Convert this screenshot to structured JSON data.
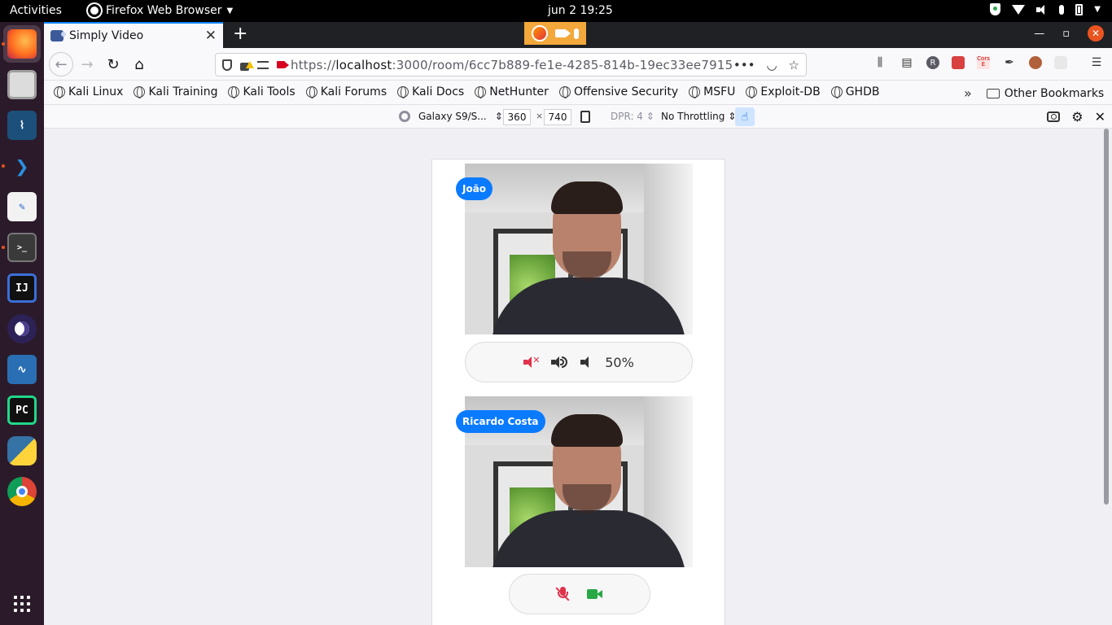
{
  "topbar": {
    "activities": "Activities",
    "app_name": "Firefox Web Browser",
    "clock": "jun 2  19:25"
  },
  "dock": {
    "items": [
      "firefox-icon",
      "files-icon",
      "mysql-workbench-icon",
      "vscode-icon",
      "text-editor-icon",
      "terminal-icon",
      "intellij-icon",
      "eclipse-icon",
      "system-monitor-icon",
      "pycharm-icon",
      "python-icon",
      "chrome-icon"
    ],
    "colors": {
      "active": "#e95420"
    }
  },
  "browser": {
    "tab_title": "Simply Video",
    "url_prefix": "https://",
    "url_host": "localhost",
    "url_rest": ":3000/room/6cc7b889-fe1e-4285-814b-19ec33ee7915",
    "bookmarks": [
      "Kali Linux",
      "Kali Training",
      "Kali Tools",
      "Kali Forums",
      "Kali Docs",
      "NetHunter",
      "Offensive Security",
      "MSFU",
      "Exploit-DB",
      "GHDB"
    ],
    "other_bookmarks": "Other Bookmarks",
    "profile_initial": "R",
    "cors_label": "Cors E"
  },
  "rdm": {
    "device": "Galaxy S9/S...",
    "width": "360",
    "times": "×",
    "height": "740",
    "dpr": "DPR: 4",
    "throttling": "No Throttling"
  },
  "page": {
    "participants": [
      {
        "name": "João",
        "volume": "50%"
      },
      {
        "name": "Ricardo Costa"
      }
    ],
    "colors": {
      "badge": "#0a7bff",
      "muted": "#e0314b",
      "camera_on": "#28a745"
    }
  }
}
